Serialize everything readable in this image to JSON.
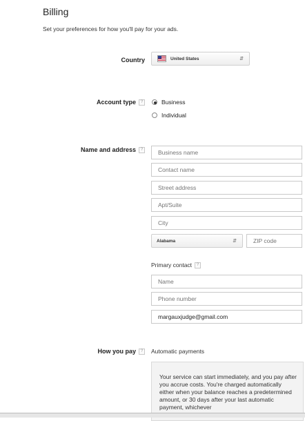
{
  "page": {
    "title": "Billing",
    "subtitle": "Set your preferences for how you'll pay for your ads."
  },
  "country": {
    "label": "Country",
    "value": "United States",
    "flag_icon": "us-flag-icon"
  },
  "account_type": {
    "label": "Account type",
    "help": "?",
    "options": [
      {
        "label": "Business",
        "checked": true
      },
      {
        "label": "Individual",
        "checked": false
      }
    ]
  },
  "name_address": {
    "label": "Name and address",
    "help": "?",
    "fields": {
      "business_name": {
        "placeholder": "Business name",
        "value": ""
      },
      "contact_name": {
        "placeholder": "Contact name",
        "value": ""
      },
      "street_address": {
        "placeholder": "Street address",
        "value": ""
      },
      "apt_suite": {
        "placeholder": "Apt/Suite",
        "value": ""
      },
      "city": {
        "placeholder": "City",
        "value": ""
      }
    },
    "state": {
      "value": "Alabama"
    },
    "zip": {
      "placeholder": "ZIP code",
      "value": ""
    }
  },
  "primary_contact": {
    "label": "Primary contact",
    "help": "?",
    "name": {
      "placeholder": "Name",
      "value": ""
    },
    "phone": {
      "placeholder": "Phone number",
      "value": ""
    },
    "email": {
      "value": "margauxjudge@gmail.com"
    }
  },
  "how_you_pay": {
    "label": "How you pay",
    "help": "?",
    "method": "Automatic payments",
    "description": "Your service can start immediately, and you pay after you accrue costs. You're charged automatically either when your balance reaches a predetermined amount, or 30 days after your last automatic payment, whichever"
  }
}
